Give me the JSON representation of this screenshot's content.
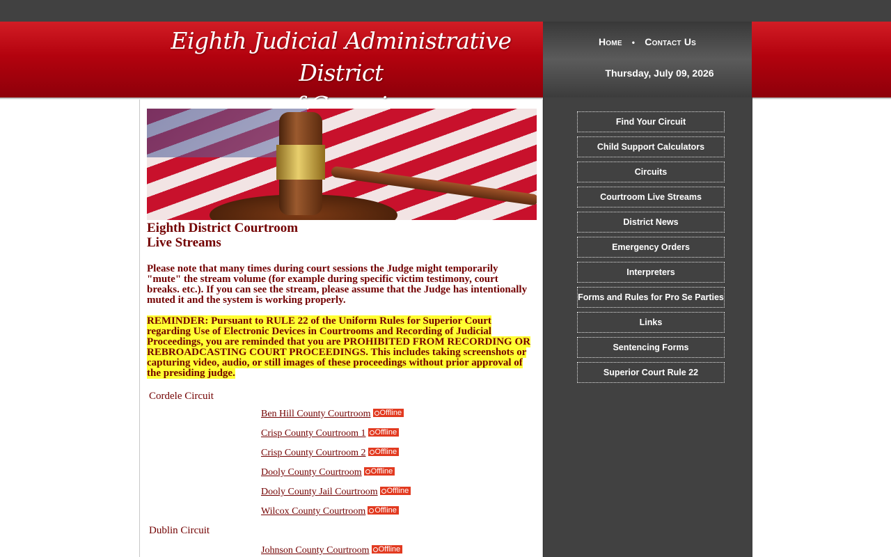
{
  "header": {
    "title_line1": "Eighth Judicial Administrative District",
    "title_line2": "of Georgia",
    "nav": {
      "home": "Home",
      "separator": "•",
      "contact": "Contact Us"
    },
    "date": "Thursday, July 09, 2026"
  },
  "main": {
    "heading_line1": "Eighth District Courtroom",
    "heading_line2": "Live Streams",
    "notice": "Please note that many times during court sessions the Judge might temporarily \"mute\" the stream volume (for example during specific victim testimony, court breaks. etc.). If you can see the stream, please assume that the Judge has intentionally muted it and the system is working properly.",
    "reminder": "REMINDER: Pursuant to RULE 22 of the Uniform Rules for Superior Court regarding Use of Electronic Devices in Courtrooms and Recording of Judicial Proceedings, you are reminded that you are PROHIBITED FROM RECORDING OR REBROADCASTING COURT PROCEEDINGS. This includes taking screenshots or capturing video, audio, or still images of these proceedings without prior approval of the presiding judge.",
    "circuits": [
      {
        "name": "Cordele Circuit",
        "courtrooms": [
          {
            "name": "Ben Hill County Courtroom",
            "status": "Offline"
          },
          {
            "name": "Crisp County Courtroom 1",
            "status": "Offline"
          },
          {
            "name": "Crisp County Courtroom 2",
            "status": "Offline"
          },
          {
            "name": "Dooly County Courtroom",
            "status": "Offline"
          },
          {
            "name": "Dooly County Jail Courtroom",
            "status": "Offline"
          },
          {
            "name": "Wilcox County Courtroom",
            "status": "Offline"
          }
        ]
      },
      {
        "name": "Dublin Circuit",
        "courtrooms": [
          {
            "name": "Johnson County Courtroom",
            "status": "Offline"
          }
        ]
      }
    ]
  },
  "sidebar": {
    "items": [
      {
        "label": "Find Your Circuit"
      },
      {
        "label": "Child Support Calculators"
      },
      {
        "label": "Circuits"
      },
      {
        "label": "Courtroom Live Streams"
      },
      {
        "label": "District News"
      },
      {
        "label": "Emergency Orders"
      },
      {
        "label": "Interpreters"
      },
      {
        "label": "Forms and Rules for Pro Se Parties"
      },
      {
        "label": "Links"
      },
      {
        "label": "Sentencing Forms"
      },
      {
        "label": "Superior Court Rule 22"
      }
    ]
  },
  "colors": {
    "banner_red": "#b3020e",
    "text_maroon": "#720000",
    "sidebar_gray": "#414141",
    "offline_badge": "#e23a20",
    "highlight_yellow": "#ffff33"
  }
}
